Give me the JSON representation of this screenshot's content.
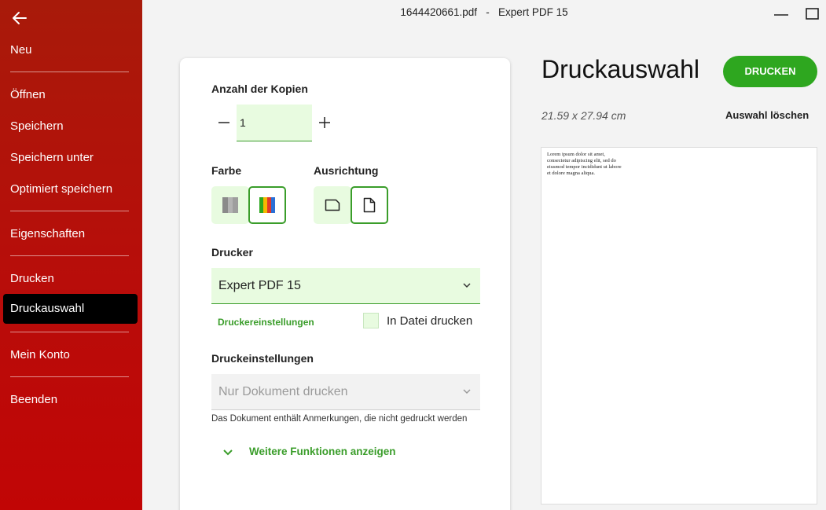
{
  "window": {
    "filename": "1644420661.pdf",
    "separator": "-",
    "app_name": "Expert PDF 15"
  },
  "sidebar": {
    "items": [
      {
        "label": "Neu"
      },
      {
        "label": "Öffnen"
      },
      {
        "label": "Speichern"
      },
      {
        "label": "Speichern unter"
      },
      {
        "label": "Optimiert speichern"
      },
      {
        "label": "Eigenschaften"
      },
      {
        "label": "Drucken"
      },
      {
        "label": "Druckauswahl"
      },
      {
        "label": "Mein Konto"
      },
      {
        "label": "Beenden"
      }
    ],
    "active": "Druckauswahl"
  },
  "form": {
    "copies_label": "Anzahl der Kopien",
    "copies_value": "1",
    "color_label": "Farbe",
    "color_selected": "color",
    "orientation_label": "Ausrichtung",
    "orientation_selected": "portrait",
    "printer_label": "Drucker",
    "printer_value": "Expert PDF 15",
    "printer_settings_link": "Druckereinstellungen",
    "print_to_file_label": "In Datei drucken",
    "print_to_file_checked": false,
    "print_settings_label": "Druckeinstellungen",
    "print_settings_value": "Nur Dokument drucken",
    "annotations_note": "Das Dokument enthält Anmerkungen, die nicht gedruckt werden",
    "more_link": "Weitere Funktionen anzeigen"
  },
  "preview_panel": {
    "heading": "Druckauswahl",
    "print_button": "DRUCKEN",
    "page_size": "21.59 x 27.94 cm",
    "clear_selection": "Auswahl löschen",
    "page_text": "Lorem ipsum dolor sit amet, consectetur adipiscing elit, sed do eiusmod tempor incididunt ut labore et dolore magna aliqua."
  },
  "colors": {
    "sidebar_red": "#b80d0a",
    "accent_green": "#2ea71f",
    "input_bg": "#e8fbe0"
  }
}
